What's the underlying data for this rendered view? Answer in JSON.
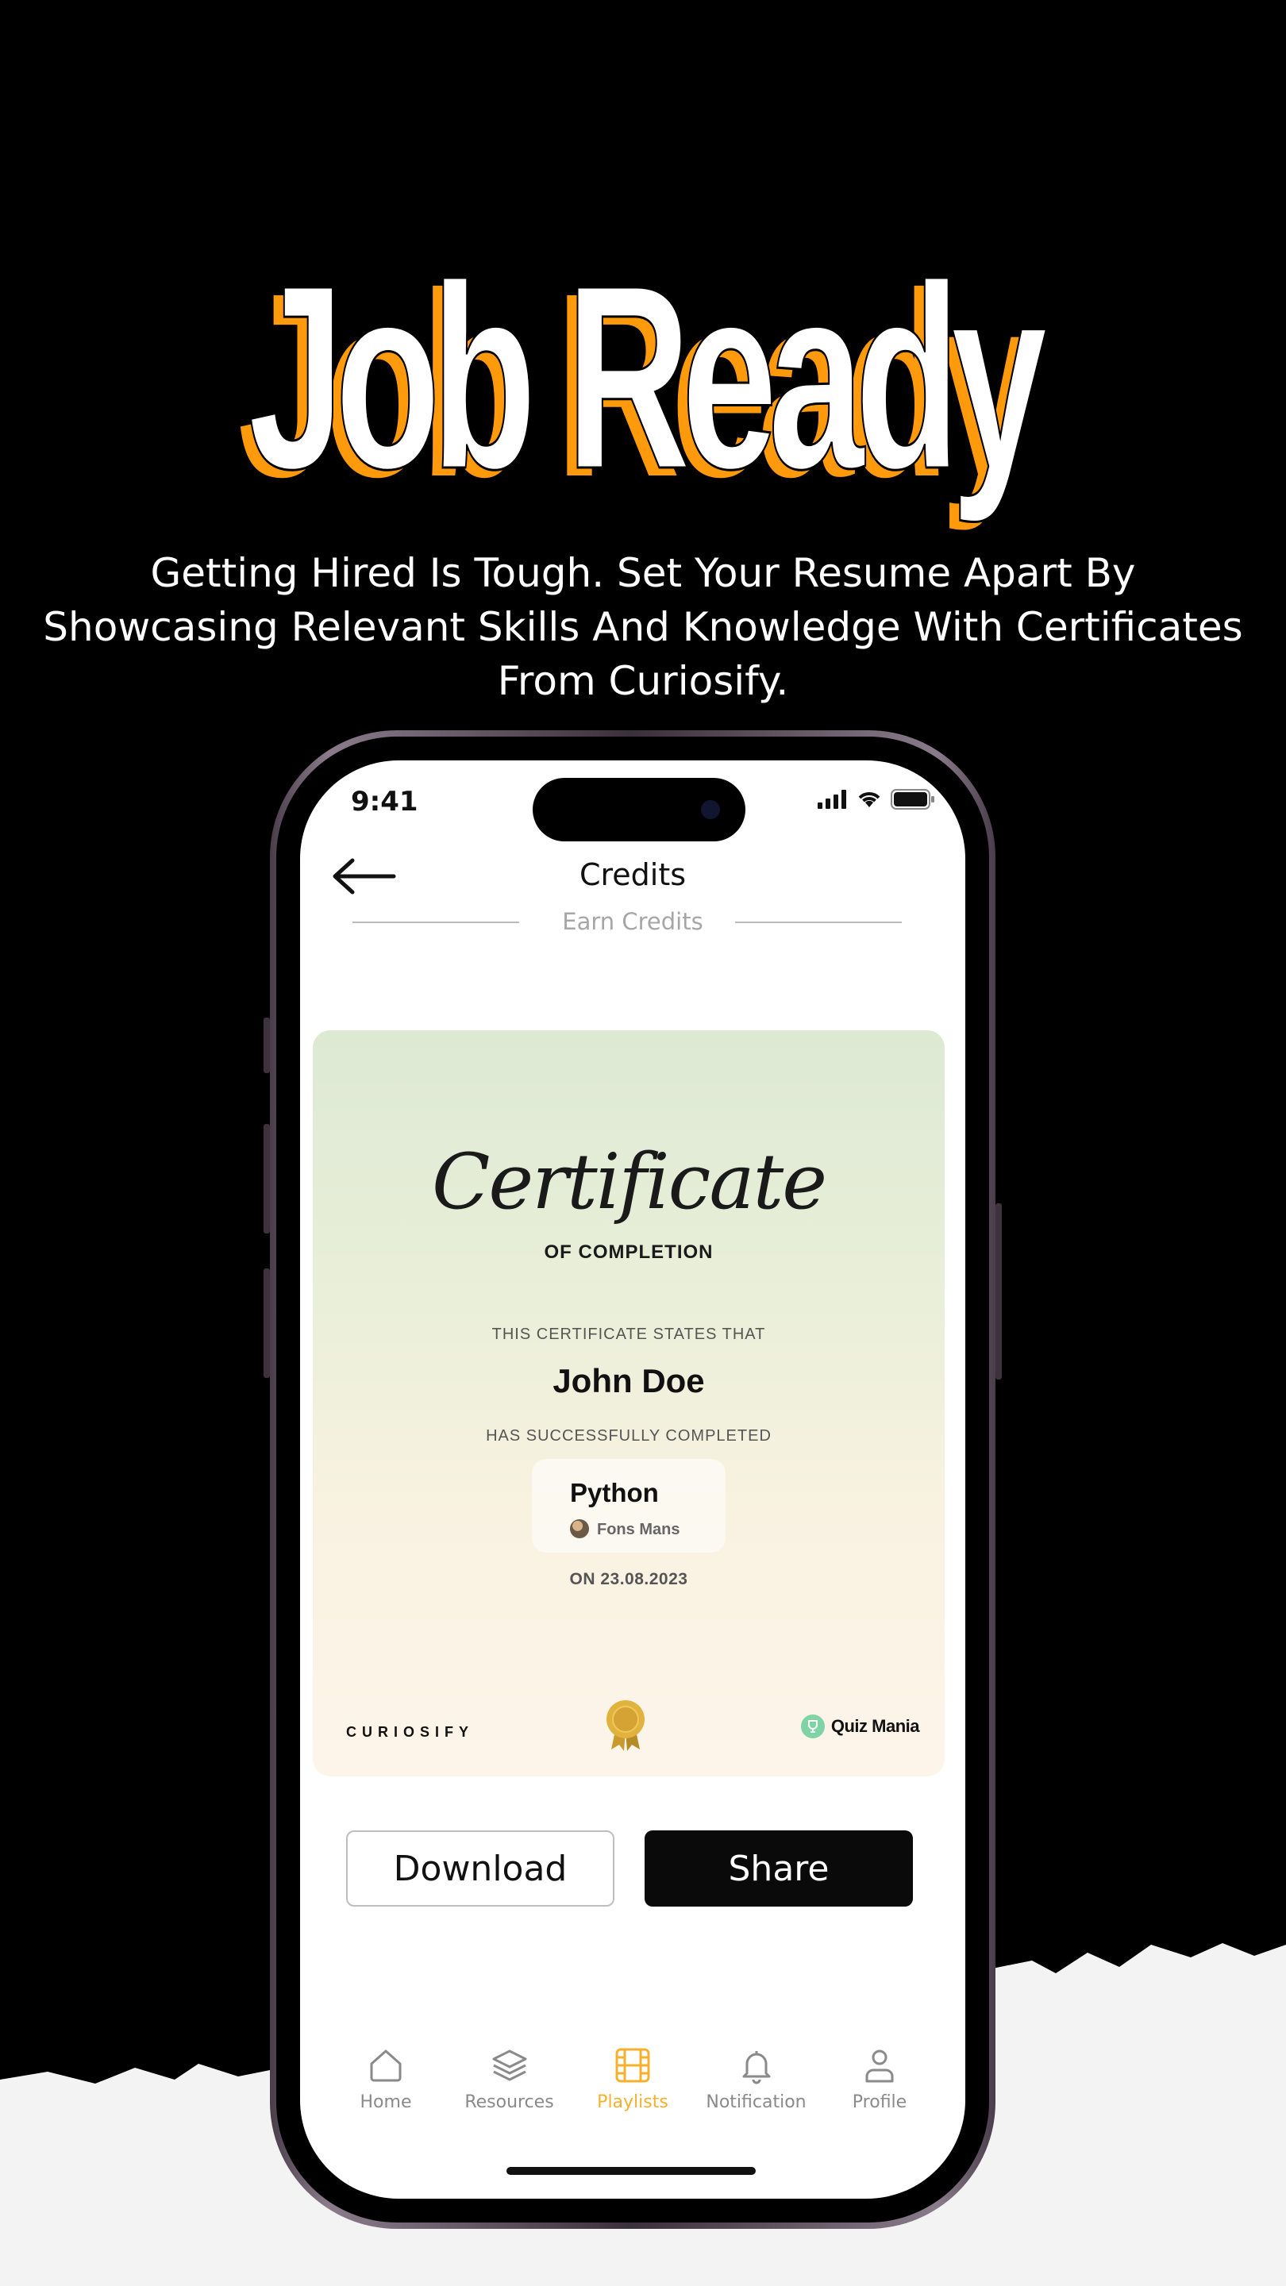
{
  "hero": {
    "headline": "Job Ready",
    "subtitle": "Getting Hired Is Tough. Set Your Resume Apart By Showcasing Relevant Skills And Knowledge With Certificates From Curiosify."
  },
  "status_bar": {
    "time": "9:41"
  },
  "header": {
    "title": "Credits",
    "sub_tab": "Earn Credits"
  },
  "certificate": {
    "title": "Certificate",
    "subtitle": "OF COMPLETION",
    "states_line": "THIS CERTIFICATE STATES THAT",
    "recipient": "John Doe",
    "completed_line": "HAS SUCCESSFULLY COMPLETED",
    "course": "Python",
    "author": "Fons Mans",
    "date_line": "ON 23.08.2023",
    "brand": "CURIOSIFY",
    "partner": "Quiz Mania"
  },
  "actions": {
    "download_label": "Download",
    "share_label": "Share"
  },
  "tabbar": {
    "items": [
      {
        "label": "Home",
        "icon": "home-icon"
      },
      {
        "label": "Resources",
        "icon": "layers-icon"
      },
      {
        "label": "Playlists",
        "icon": "film-icon",
        "active": true
      },
      {
        "label": "Notification",
        "icon": "bell-icon"
      },
      {
        "label": "Profile",
        "icon": "user-icon"
      }
    ]
  },
  "colors": {
    "accent": "#FF9A0D",
    "active_tab": "#F5B02E",
    "background": "#000000"
  }
}
